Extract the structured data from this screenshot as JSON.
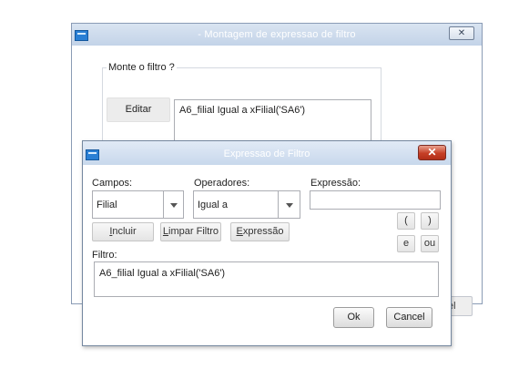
{
  "outer_window": {
    "title": "- Montagem de expressao de filtro",
    "close_label": "✕",
    "group_label": "Monte o filtro ?",
    "edit_button": "Editar",
    "filter_text": "A6_filial  Igual a   xFilial('SA6')",
    "partial_button": "el"
  },
  "dialog": {
    "title": "Expressao de Filtro",
    "close_label": "✕",
    "campos_label": "Campos:",
    "campos_value": "Filial",
    "operadores_label": "Operadores:",
    "operadores_value": "Igual a",
    "expressao_label": "Expressão:",
    "expressao_value": "",
    "buttons": {
      "incluir": {
        "first": "I",
        "rest": "ncluir"
      },
      "limpar": {
        "first": "L",
        "rest": "impar Filtro"
      },
      "expressao": {
        "first": "E",
        "rest": "xpressão"
      }
    },
    "ops": {
      "open_paren": "(",
      "close_paren": ")",
      "and": "e",
      "or": "ou"
    },
    "filtro_label": "Filtro:",
    "filtro_text": "A6_filial  Igual a   xFilial('SA6')",
    "ok_button": "Ok",
    "cancel_button": "Cancel"
  },
  "icons": [
    "app-icon",
    "close-icon",
    "chevron-down-icon"
  ]
}
